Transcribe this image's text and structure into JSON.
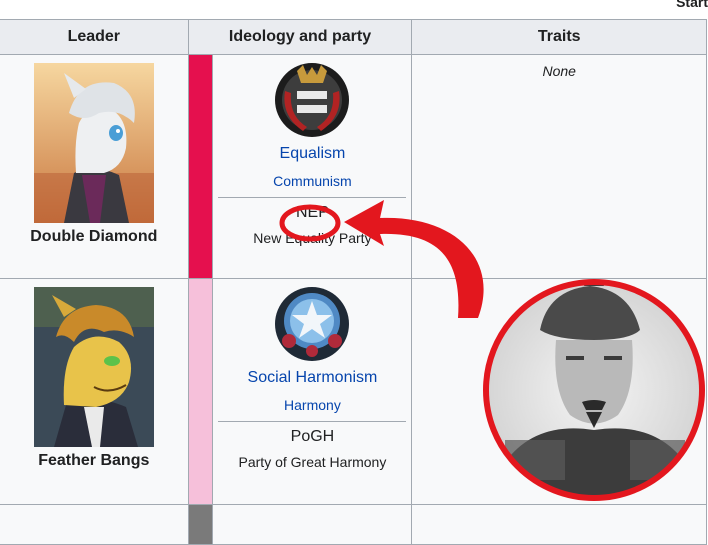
{
  "header_fragment": "Start",
  "columns": {
    "leader": "Leader",
    "ideology": "Ideology and party",
    "traits": "Traits"
  },
  "rows": [
    {
      "leader": "Double Diamond",
      "ideology": "Equalism",
      "group": "Communism",
      "party_short": "NEP",
      "party_full": "New Equality Party",
      "traits": "None",
      "bar_color": "#e5104e",
      "portrait_bg": "#d9a470",
      "pony_color": "#e9ecef",
      "emblem_icon": "equality-emblem-icon"
    },
    {
      "leader": "Feather Bangs",
      "ideology": "Social Harmonism",
      "group": "Harmony",
      "party_short": "PoGH",
      "party_full": "Party of Great Harmony",
      "traits": "",
      "bar_color": "#f6c0da",
      "portrait_bg": "#3b4a57",
      "pony_color": "#e8c34a",
      "emblem_icon": "star-emblem-icon"
    }
  ],
  "annotation": {
    "circle_color": "#e3171e",
    "arrow_color": "#e3171e",
    "photo_icon": "person-photo-icon"
  }
}
